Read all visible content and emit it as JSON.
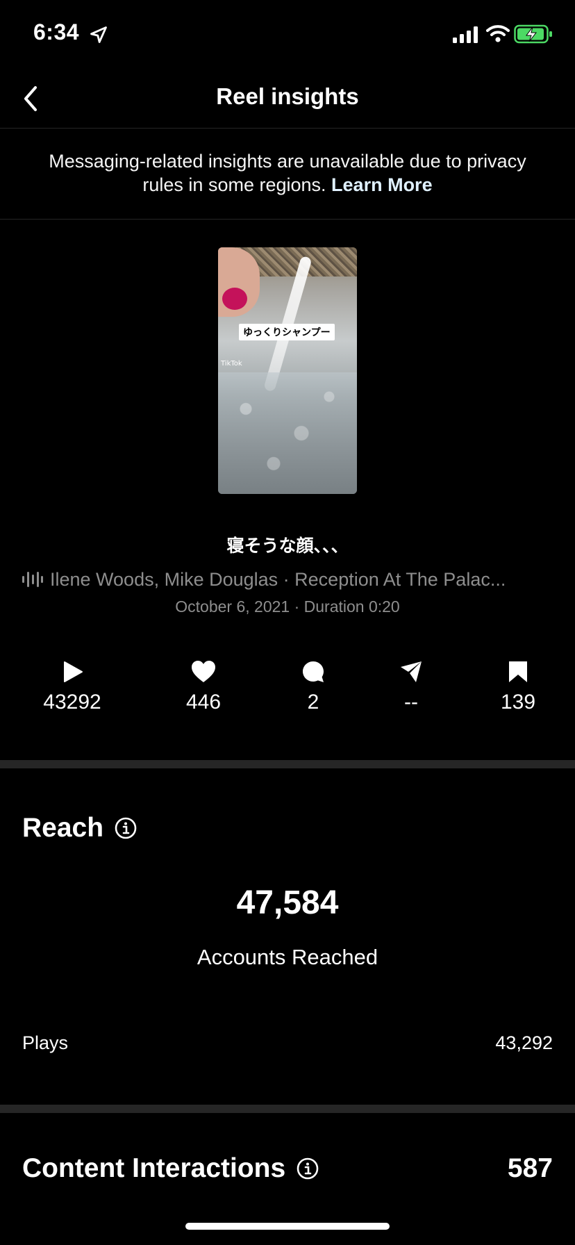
{
  "status_bar": {
    "time": "6:34",
    "icons": [
      "location-arrow-icon",
      "cellular-signal-icon",
      "wifi-icon",
      "battery-charging-icon"
    ]
  },
  "nav": {
    "title": "Reel insights",
    "back_icon": "chevron-left-icon"
  },
  "notice": {
    "text": "Messaging-related insights are unavailable due to privacy rules in some regions.",
    "link": "Learn More"
  },
  "reel": {
    "thumbnail_caption": "ゆっくりシャンプー",
    "thumbnail_watermark": "TikTok",
    "caption": "寝そうな顔、、、",
    "audio": "Ilene Woods, Mike Douglas · Reception At The Palac...",
    "meta": "October 6, 2021 · Duration 0:20"
  },
  "metrics": [
    {
      "icon": "play-icon",
      "value": "43292"
    },
    {
      "icon": "heart-icon",
      "value": "446"
    },
    {
      "icon": "comment-icon",
      "value": "2"
    },
    {
      "icon": "share-icon",
      "value": "--"
    },
    {
      "icon": "bookmark-icon",
      "value": "139"
    }
  ],
  "reach": {
    "title": "Reach",
    "value": "47,584",
    "label": "Accounts Reached",
    "rows": [
      {
        "label": "Plays",
        "value": "43,292"
      }
    ]
  },
  "interactions": {
    "title": "Content Interactions",
    "value": "587"
  },
  "colors": {
    "background": "#000000",
    "secondary_text": "#8e8e8e",
    "divider": "#262626",
    "battery_green": "#4cd964",
    "nail_pink": "#c4125a"
  }
}
